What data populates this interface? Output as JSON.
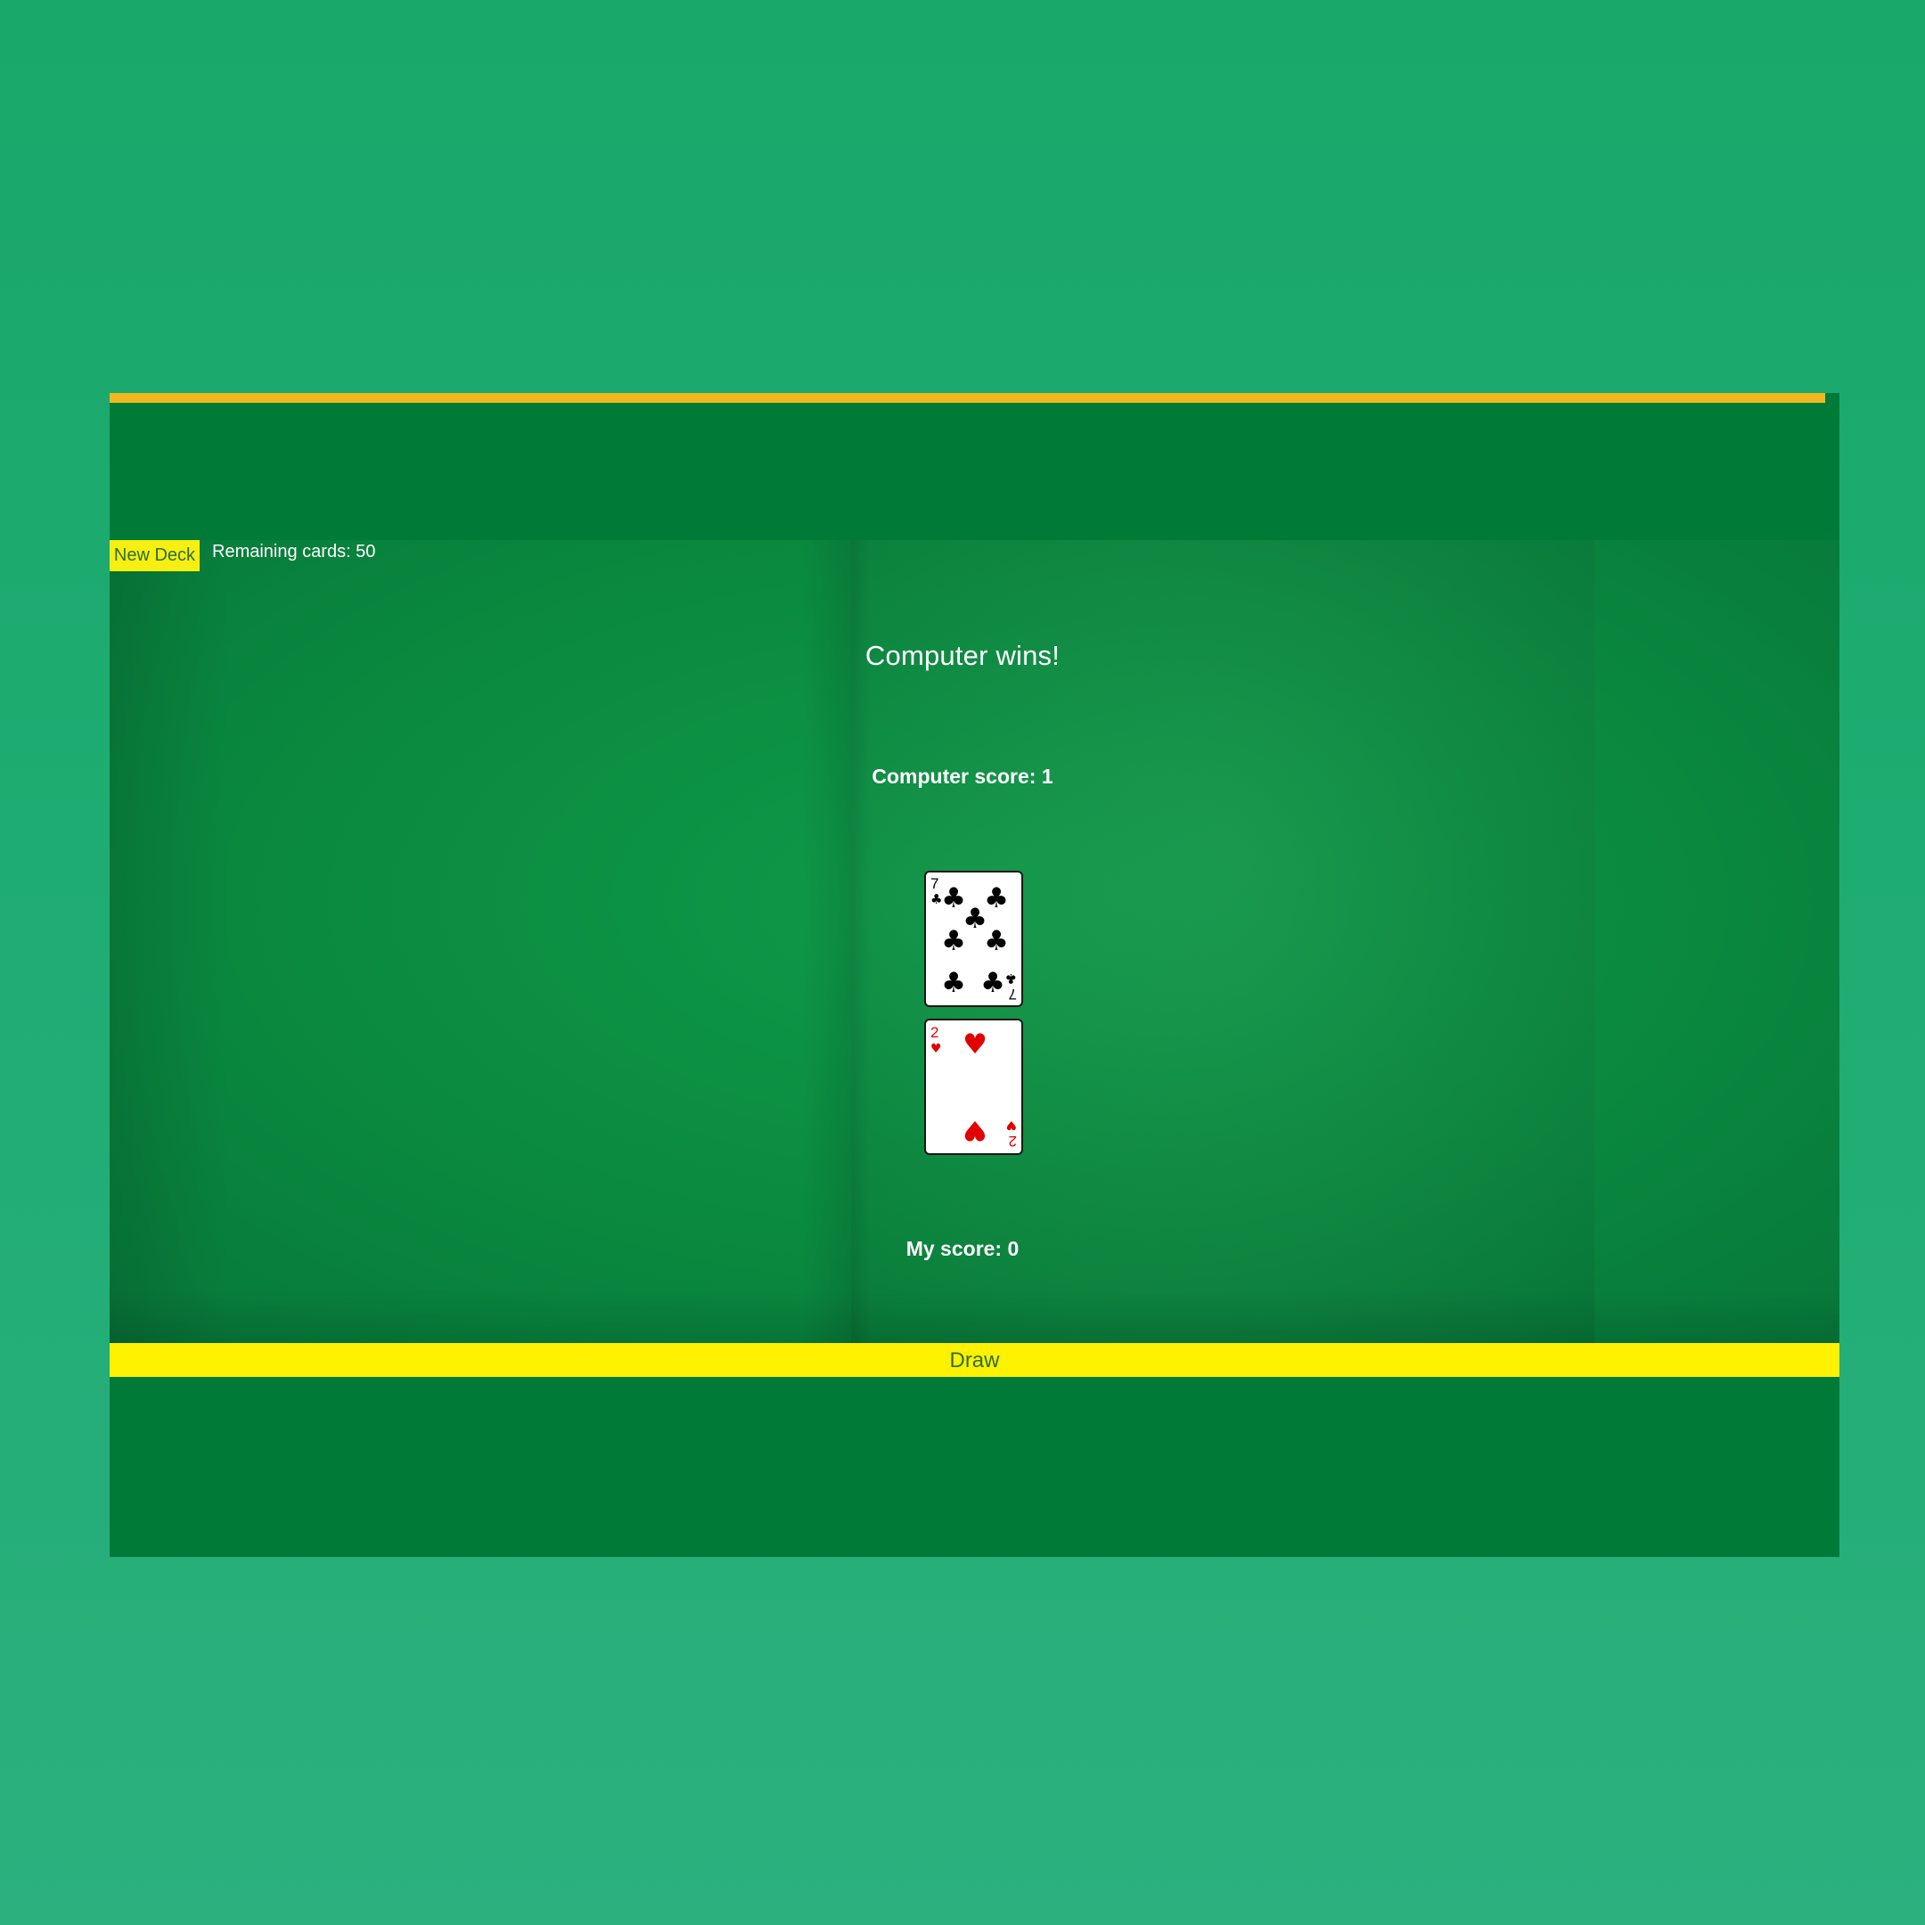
{
  "controls": {
    "new_deck_label": "New Deck",
    "remaining_cards": "Remaining cards: 50",
    "draw_label": "Draw"
  },
  "game": {
    "result_message": "Computer wins!",
    "computer_score": "Computer score: 1",
    "my_score": "My score: 0"
  },
  "cards": {
    "computer": {
      "rank": "7",
      "suit": "clubs",
      "suit_symbol": "♣",
      "color": "#000000"
    },
    "player": {
      "rank": "2",
      "suit": "hearts",
      "suit_symbol": "♥",
      "color": "#e00000"
    }
  },
  "colors": {
    "accent_yellow": "#fff200",
    "top_accent": "#f0b81c",
    "table_green": "#0a8a3f",
    "background_green": "#1fac72"
  }
}
